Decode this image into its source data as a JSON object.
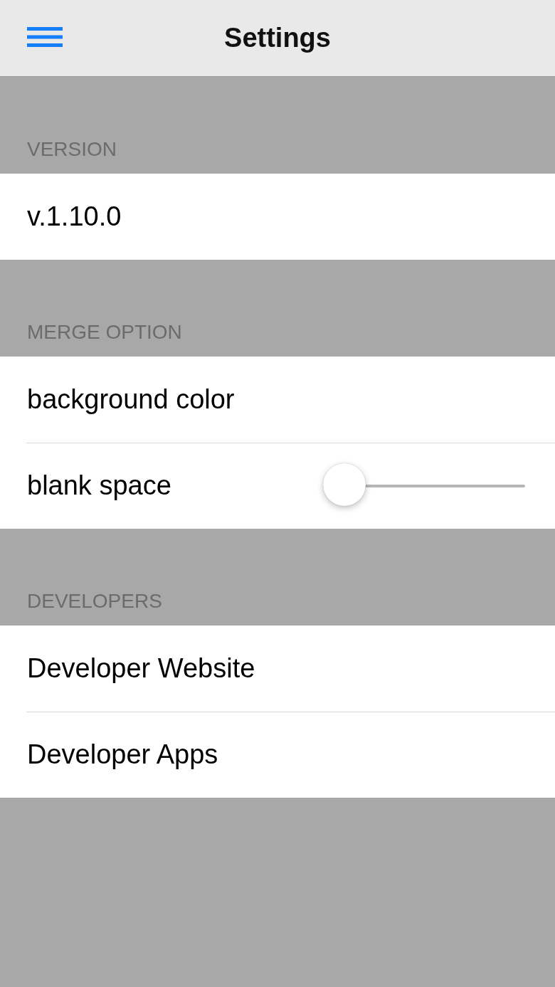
{
  "nav_bar": {
    "title": "Settings"
  },
  "sections": [
    {
      "header": "VERSION",
      "rows": [
        {
          "kind": "text",
          "label": "v.1.10.0"
        }
      ]
    },
    {
      "header": "MERGE OPTION",
      "rows": [
        {
          "kind": "text",
          "label": "background color"
        },
        {
          "kind": "slider",
          "label": "blank space",
          "level": 0
        }
      ]
    },
    {
      "header": "DEVELOPERS",
      "rows": [
        {
          "kind": "text",
          "label": "Developer Website"
        },
        {
          "kind": "text",
          "label": "Developer Apps"
        }
      ]
    }
  ]
}
